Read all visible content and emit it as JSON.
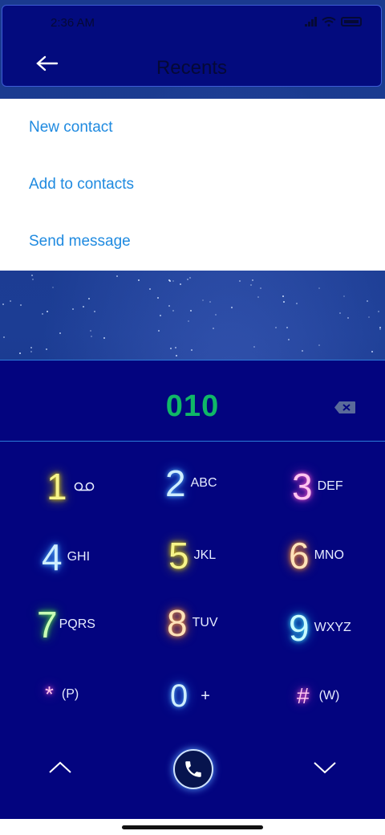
{
  "status_bar": {
    "time": "2:36 AM"
  },
  "header": {
    "title": "Recents"
  },
  "menu": {
    "items": [
      {
        "label": "New contact"
      },
      {
        "label": "Add to contacts"
      },
      {
        "label": "Send message"
      }
    ]
  },
  "dialer": {
    "number": "010",
    "keys": [
      {
        "digit": "1",
        "letters": ""
      },
      {
        "digit": "2",
        "letters": "ABC"
      },
      {
        "digit": "3",
        "letters": "DEF"
      },
      {
        "digit": "4",
        "letters": "GHI"
      },
      {
        "digit": "5",
        "letters": "JKL"
      },
      {
        "digit": "6",
        "letters": "MNO"
      },
      {
        "digit": "7",
        "letters": "PQRS"
      },
      {
        "digit": "8",
        "letters": "TUV"
      },
      {
        "digit": "9",
        "letters": "WXYZ"
      },
      {
        "digit": "*",
        "letters": "(P)"
      },
      {
        "digit": "0",
        "letters": "+"
      },
      {
        "digit": "#",
        "letters": "(W)"
      }
    ]
  },
  "icons": {
    "voicemail": "voicemail-icon",
    "call": "phone-icon",
    "backspace": "backspace-icon",
    "back": "arrow-left-icon"
  },
  "colors": {
    "dialer_background": "#03047f",
    "number_color": "#10b867",
    "menu_text": "#1f8ae0",
    "header_background": "#030b7e"
  }
}
